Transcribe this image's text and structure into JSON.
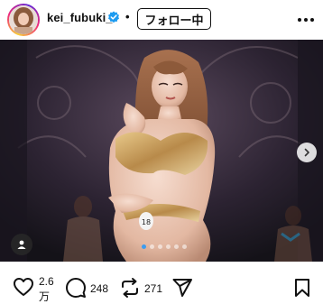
{
  "header": {
    "username": "kei_fubuki_",
    "separator": "•",
    "follow_label": "フォロー中"
  },
  "icons": {
    "avatar": "profile-photo",
    "verified": "verified-badge-icon",
    "more": "more-options-icon",
    "tag": "user-tag-icon",
    "next": "chevron-right-icon",
    "like": "heart-icon",
    "comment": "comment-bubble-icon",
    "repost": "repost-icon",
    "share": "send-paper-plane-icon",
    "save": "bookmark-icon"
  },
  "carousel": {
    "slide_count": 6,
    "current_index": 1
  },
  "actions": {
    "likes_line1": "2.6",
    "likes_line2": "万",
    "comments": "248",
    "reposts": "271"
  },
  "colors": {
    "verified": "#1d9bf0",
    "pager_active": "#3d9cf0"
  }
}
